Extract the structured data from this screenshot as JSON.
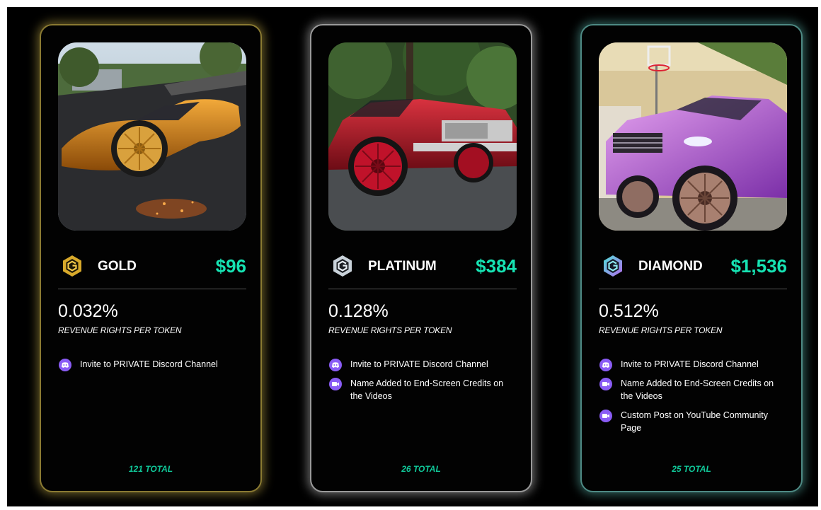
{
  "cards": [
    {
      "tier": "GOLD",
      "price": "$96",
      "percent": "0.032%",
      "rights_label": "REVENUE RIGHTS PER TOKEN",
      "perks": [
        "Invite to PRIVATE Discord Channel"
      ],
      "total": "121 TOTAL",
      "accent": "#c9a53a",
      "car_color": "#e08a1e"
    },
    {
      "tier": "PLATINUM",
      "price": "$384",
      "percent": "0.128%",
      "rights_label": "REVENUE RIGHTS PER TOKEN",
      "perks": [
        "Invite to PRIVATE Discord Channel",
        "Name Added to End-Screen Credits on the Videos"
      ],
      "total": "26 TOTAL",
      "accent": "#c8c8c8",
      "car_color": "#b5192b"
    },
    {
      "tier": "DIAMOND",
      "price": "$1,536",
      "percent": "0.512%",
      "rights_label": "REVENUE RIGHTS PER TOKEN",
      "perks": [
        "Invite to PRIVATE Discord Channel",
        "Name Added to End-Screen Credits on the Videos",
        "Custom Post on YouTube Community Page"
      ],
      "total": "25 TOTAL",
      "accent": "#5fbeb4",
      "car_color": "#b45fd8"
    }
  ],
  "icons": {
    "tier_logo": "hexagon-g-logo-icon",
    "perk_discord": "discord-icon",
    "perk_video": "video-camera-icon"
  },
  "colors": {
    "price": "#16e3b3",
    "total": "#10c99a",
    "perk_icon_bg": "#8a5cf5",
    "background": "#000000"
  }
}
